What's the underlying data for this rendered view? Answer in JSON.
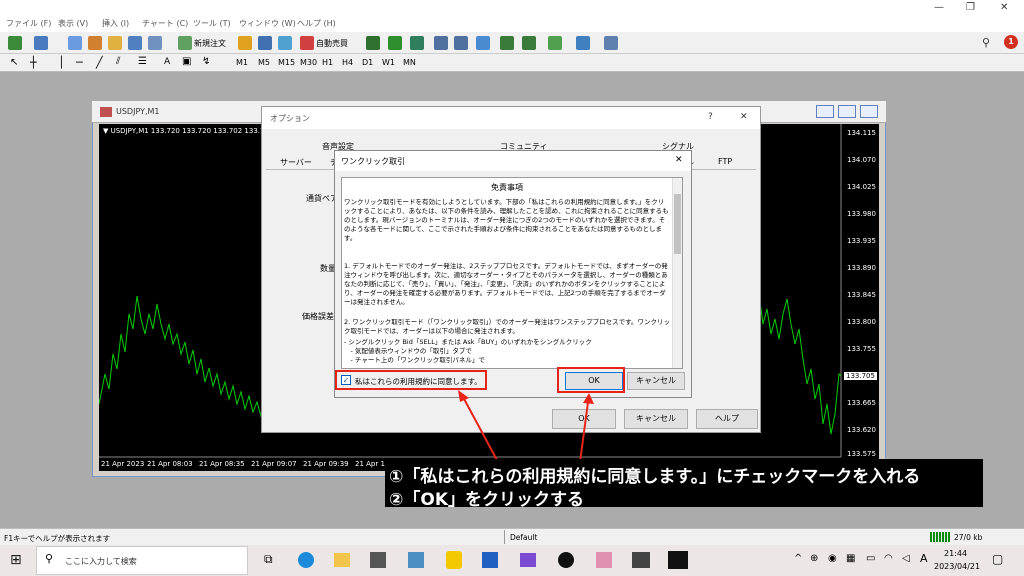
{
  "menu": [
    "ファイル (F)",
    "表示 (V)",
    "挿入 (I)",
    "チャート (C)",
    "ツール (T)",
    "ウィンドウ (W)",
    "ヘルプ (H)"
  ],
  "toolbar": {
    "new_order": "新規注文",
    "auto_trade": "自動売買",
    "timeframes": [
      "M1",
      "M5",
      "M15",
      "M30",
      "H1",
      "H4",
      "D1",
      "W1",
      "MN"
    ]
  },
  "chart": {
    "title": "USDJPY,M1",
    "quote": "▼ USDJPY,M1  133.720 133.720 133.702 133.709",
    "price_labels": [
      "134.115",
      "134.070",
      "134.025",
      "133.980",
      "133.935",
      "133.890",
      "133.845",
      "133.800",
      "133.755",
      "133.705",
      "133.665",
      "133.620",
      "133.575"
    ],
    "time_labels": [
      "21 Apr 2023",
      "21 Apr 08:03",
      "21 Apr 08:35",
      "21 Apr 09:07",
      "21 Apr 09:39",
      "21 Apr 10:11"
    ]
  },
  "options_dialog": {
    "title": "オプション",
    "help": "?",
    "close": "✕",
    "tabs_top": [
      "音声設定",
      "コミュニティ",
      "シグナル"
    ],
    "tabs_bottom": [
      "サーバー",
      "チ",
      "ル",
      "FTP"
    ],
    "labels": [
      "通貨ペア",
      "数量",
      "価格誤差"
    ],
    "ok": "OK",
    "cancel": "キャンセル",
    "help_button": "ヘルプ"
  },
  "oneclick_dialog": {
    "title": "ワンクリック取引",
    "close": "✕",
    "heading": "免責事項",
    "para1": "ワンクリック取引モードを有効にしようとしています。下部の「私はこれらの利用規約に同意します。」をクリックすることにより、あなたは、以下の条件を読み、理解したことを認め、これに拘束されることに同意するものとします。現バージョンのトーミナルは、オーダー発注につぎの2つのモードのいずれかを選択できます。そのような各モードに関して、ここで示された手順および条件に拘束されることをあなたは同意するものとします。",
    "para2": "1. デフォルトモードでのオーダー発注は、2ステッププロセスです。デフォルトモードでは、まずオーダーの発注ウィンドウを呼び出します。次に、適切なオーダー・タイプとそのパラメータを選択し、オーダーの種類とあなたの判断に応じて、「売り」、「買い」、「発注」、「変更」、「決済」のいずれかのボタンをクリックすることにより、オーダーの発注を確定する必要があります。デフォルトモードでは、上記2つの手順を完了するまでオーダーは発注されません。",
    "para3": "2. ワンクリック取引モード（「ワンクリック取引」）でのオーダー発注はワンステッププロセスです。ワンクリック取引モードでは、オーダーは以下の場合に発注されます。",
    "para4": "- シングルクリック Bid「SELL」または Ask「BUY」のいずれかをシングルクリック",
    "para5": "　- 気配値表示ウィンドウの「取引」タブで",
    "para6": "　- チャート上の「ワンクリック取引パネル」で",
    "checkbox": "私はこれらの利用規約に同意します。",
    "checked": true,
    "ok": "OK",
    "cancel": "キャンセル"
  },
  "caption": {
    "line1": "①「私はこれらの利用規約に同意します。」にチェックマークを入れる",
    "line2": "②「OK」をクリックする"
  },
  "status": {
    "help": "F1キーでヘルプが表示されます",
    "profile": "Default",
    "traffic": "27/0 kb"
  },
  "taskbar": {
    "search": "ここに入力して検索",
    "time": "21:44",
    "date": "2023/04/21",
    "ime": "A"
  },
  "colors": {
    "accent_red": "#e8241a",
    "chart_line": "#00d000",
    "chart_bg": "#000000"
  }
}
